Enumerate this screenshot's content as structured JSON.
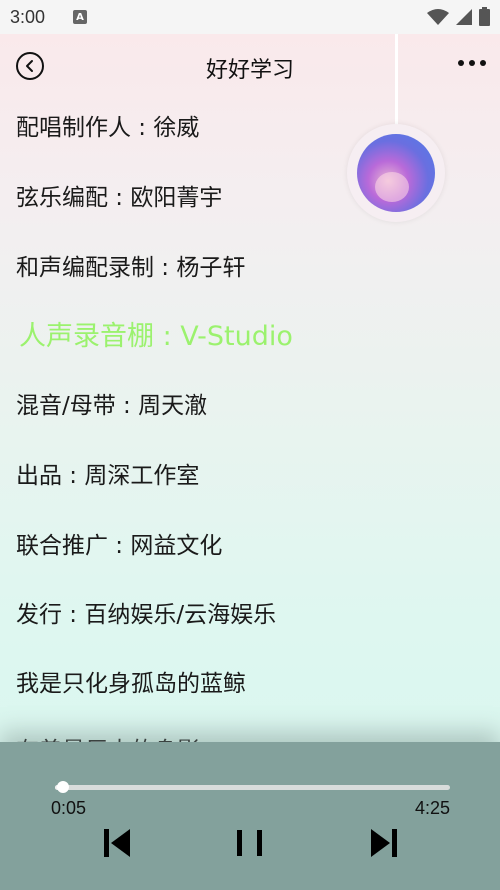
{
  "status_bar": {
    "time": "3:00",
    "app_icon_letter": "A"
  },
  "header": {
    "title": "好好学习"
  },
  "lyrics": [
    "配唱制作人 : 徐威",
    "弦乐编配 : 欧阳菁宇",
    "和声编配录制 : 杨子轩",
    "人声录音棚 : V-Studio",
    "混音/母带 : 周天澈",
    "出品 : 周深工作室",
    "联合推广 : 网益文化",
    "发行 : 百纳娱乐/云海娱乐",
    "我是只化身孤岛的蓝鲸",
    "有着最巨大的身影"
  ],
  "active_lyric_index": 3,
  "player": {
    "current_time": "0:05",
    "total_time": "4:25",
    "progress_fraction": 0.02
  },
  "colors": {
    "active_lyric": "#9bf26e",
    "player_bg": "#83a19c"
  },
  "icons": {
    "back": "circle-chevron-left-icon",
    "more": "three-dots-icon",
    "prev": "skip-previous-icon",
    "pause": "pause-icon",
    "next": "skip-next-icon"
  }
}
